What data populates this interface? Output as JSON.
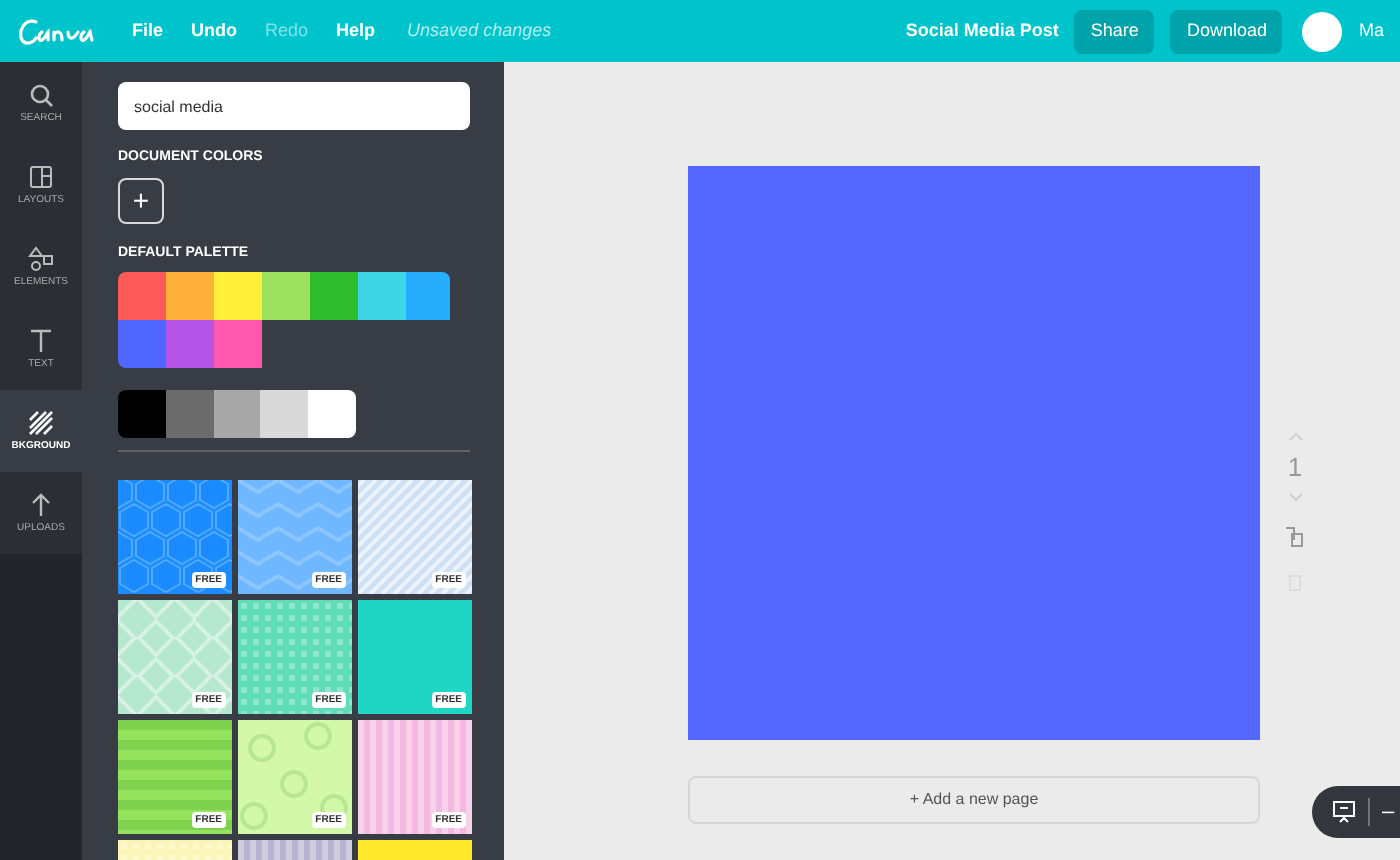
{
  "topbar": {
    "menu": [
      {
        "label": "File",
        "disabled": false
      },
      {
        "label": "Undo",
        "disabled": false
      },
      {
        "label": "Redo",
        "disabled": true
      },
      {
        "label": "Help",
        "disabled": false
      }
    ],
    "status": "Unsaved changes",
    "doc_title": "Social Media Post",
    "buttons": [
      "Share",
      "Download"
    ],
    "user": "Ma"
  },
  "rail": [
    {
      "label": "SEARCH",
      "kind": "search",
      "selected": false
    },
    {
      "label": "LAYOUTS",
      "kind": "layouts",
      "selected": false
    },
    {
      "label": "ELEMENTS",
      "kind": "elements",
      "selected": false
    },
    {
      "label": "TEXT",
      "kind": "text",
      "selected": false
    },
    {
      "label": "BKGROUND",
      "kind": "background",
      "selected": true
    },
    {
      "label": "UPLOADS",
      "kind": "uploads",
      "selected": false
    }
  ],
  "panel": {
    "search": {
      "value": "social media"
    },
    "document_colors": {
      "heading": "DOCUMENT COLORS",
      "add": "+"
    },
    "default_palette": {
      "heading": "DEFAULT PALETTE",
      "colors": [
        {
          "color": "#ff5a5a"
        },
        {
          "color": "#ffb03a"
        },
        {
          "color": "#ffef3a"
        },
        {
          "color": "#9de25e"
        },
        {
          "color": "#2ebd2e"
        },
        {
          "color": "#3ed6e6"
        },
        {
          "color": "#26aefc"
        },
        {
          "color": "#4f67ff"
        },
        {
          "color": "#b455e8"
        },
        {
          "color": "#ff58ad"
        }
      ]
    },
    "grays": [
      {
        "color": "#000000"
      },
      {
        "color": "#6b6b6b"
      },
      {
        "color": "#a8a8a8"
      },
      {
        "color": "#d9d9d9"
      },
      {
        "color": "#ffffff"
      }
    ],
    "backgrounds": [
      {
        "kind": "hexagon",
        "color": "#1a8cff",
        "badge": "FREE"
      },
      {
        "kind": "chevron",
        "color": "#6fb8ff",
        "badge": "FREE"
      },
      {
        "kind": "diagonal",
        "color": "#cfe0f5",
        "badge": "FREE"
      },
      {
        "kind": "diamond",
        "color": "#b5e8cf",
        "badge": "FREE"
      },
      {
        "kind": "dots",
        "color": "#5fdcb8",
        "badge": "FREE"
      },
      {
        "kind": "plain",
        "color": "#1fd6c4",
        "badge": "FREE"
      },
      {
        "kind": "hstripes",
        "color": "#95e25c",
        "badge": "FREE"
      },
      {
        "kind": "circles",
        "color": "#d3f9a8",
        "badge": "FREE"
      },
      {
        "kind": "vstripes",
        "color": "#f5b8e0",
        "badge": "FREE"
      },
      {
        "kind": "dots",
        "color": "#fbf6b8"
      },
      {
        "kind": "vstripes",
        "color": "#b8b3cf"
      },
      {
        "kind": "plain",
        "color": "#ffe92a"
      }
    ]
  },
  "canvas": {
    "design": {
      "color": "#5468ff"
    },
    "page_number": "1",
    "add_page": "+ Add a new page"
  },
  "zoom_bar": {
    "zoom_out": "–"
  }
}
